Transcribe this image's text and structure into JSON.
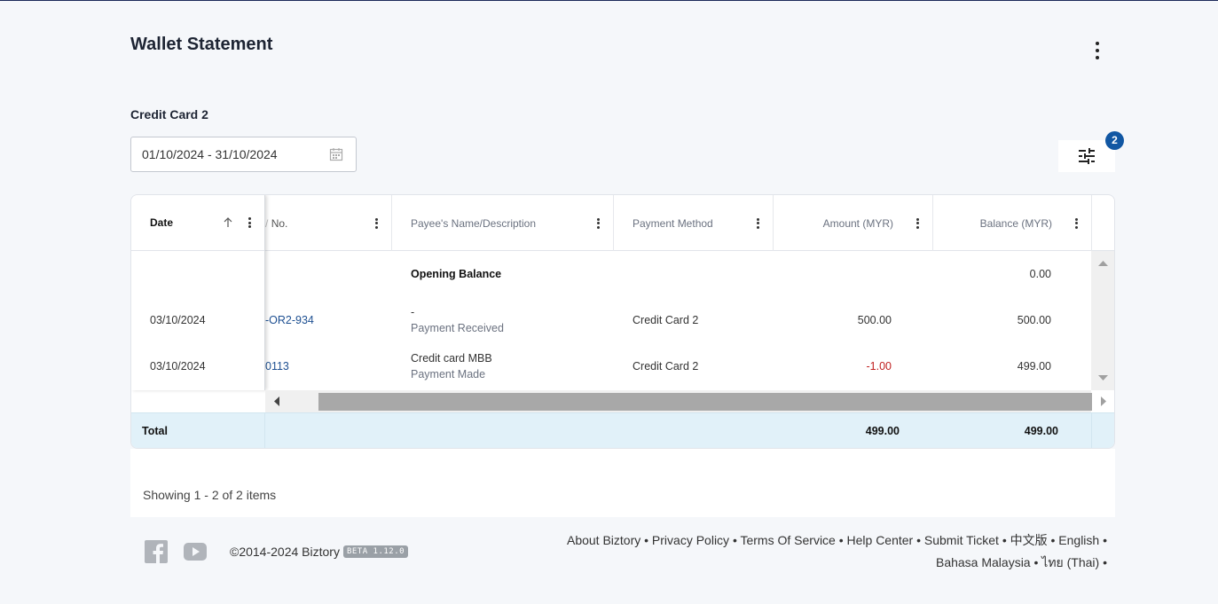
{
  "page": {
    "title": "Wallet Statement",
    "wallet_name": "Credit Card 2",
    "date_range": "01/10/2024 - 31/10/2024",
    "filter_count": "2"
  },
  "columns": {
    "date": "Date",
    "ref": "No.",
    "payee": "Payee's Name/Description",
    "method": "Payment Method",
    "amount": "Amount (MYR)",
    "balance": "Balance (MYR)"
  },
  "opening": {
    "label": "Opening Balance",
    "balance": "0.00"
  },
  "rows": [
    {
      "date": "03/10/2024",
      "ref": "-OR2-934",
      "payee": "-",
      "type": "Payment Received",
      "method": "Credit Card 2",
      "amount": "500.00",
      "balance": "500.00"
    },
    {
      "date": "03/10/2024",
      "ref": "0113",
      "payee": "Credit card MBB",
      "type": "Payment Made",
      "method": "Credit Card 2",
      "amount": "-1.00",
      "balance": "499.00"
    }
  ],
  "total": {
    "label": "Total",
    "amount": "499.00",
    "balance": "499.00"
  },
  "pager": {
    "showing": "Showing 1 - 2 of 2 items"
  },
  "footer": {
    "line1": "About Biztory • Privacy Policy • Terms Of Service • Help Center • Submit Ticket • 中文版 • English •",
    "line2": "Bahasa Malaysia • ไทย (Thai) •",
    "copyright": "©2014-2024 Biztory",
    "beta": "BETA 1.12.0"
  },
  "colors": {
    "accent": "#1157a3",
    "negative": "#c02020",
    "total_bg": "#e1f1f9"
  }
}
